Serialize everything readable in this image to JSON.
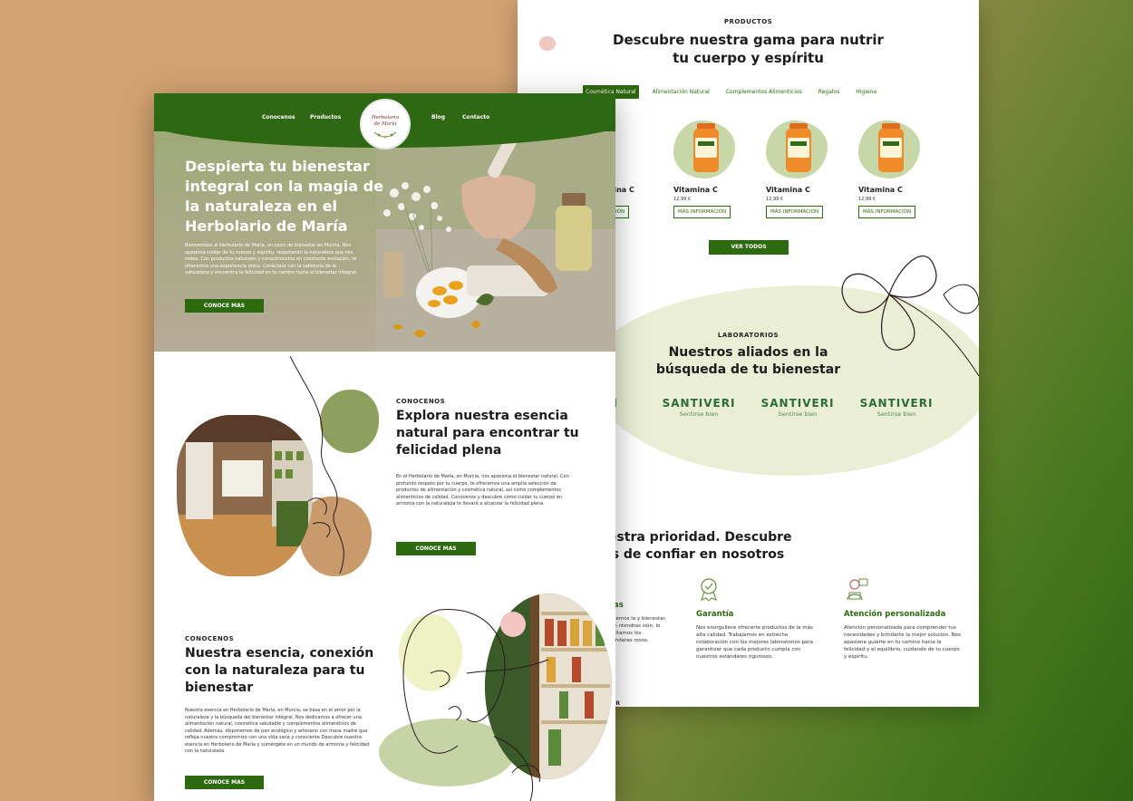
{
  "back_page": {
    "products": {
      "eyebrow": "PRODUCTOS",
      "title": "Descubre nuestra gama para nutrir tu cuerpo y espíritu",
      "tabs": [
        "Cosmética Natural",
        "Alimentación Natural",
        "Complementos Alimenticios",
        "Regalos",
        "Higiene"
      ],
      "items": [
        {
          "name": "Vitamina C",
          "price": "12,99 €",
          "button": "MÁS INFORMACIÓN"
        },
        {
          "name": "Vitamina C",
          "price": "12,99 €",
          "button": "MÁS INFORMACIÓN"
        },
        {
          "name": "Vitamina C",
          "price": "12,99 €",
          "button": "MÁS INFORMACIÓN"
        },
        {
          "name": "Vitamina C",
          "price": "12,99 €",
          "button": "MÁS INFORMACIÓN"
        }
      ],
      "view_all": "VER TODOS"
    },
    "labs": {
      "eyebrow": "LABORATORIOS",
      "title": "Nuestros aliados en la búsqueda de tu bienestar",
      "logos": [
        {
          "brand": "SANTIVERI",
          "tagline": "Sentirse bien"
        },
        {
          "brand": "SANTIVERI",
          "tagline": "Sentirse bien"
        },
        {
          "brand": "SANTIVERI",
          "tagline": "Sentirse bien"
        },
        {
          "brand": "SANTIVERI",
          "tagline": "Sentirse bien"
        }
      ]
    },
    "priority": {
      "eyebrow": "S",
      "title_line1": "nuestra prioridad. Descubre",
      "title_line2": "ajas de confiar en nosotros",
      "features": [
        {
          "title": "oras",
          "text": "rendemos la y bienestar. Si un ntendras sión, lo solicitamos los estándares rosos.",
          "icon": "leaf-icon"
        },
        {
          "title": "Garantía",
          "text": "Nos enorgullece ofrecerte productos de la más alta calidad. Trabajamos en estrecha colaboración con los mejores laboratorios para garantizar que cada producto cumpla con nuestros estándares rigurosos.",
          "icon": "award-icon"
        },
        {
          "title": "Atención personalizada",
          "text": "Atención personalizada para comprender tus necesidades y brindarte la mejor solución. Nos apasiona guiarte en tu camino hacia la felicidad y el equilibrio, cuidando de tu cuerpo y espíritu.",
          "icon": "support-icon"
        }
      ],
      "footer_fragment": "SER"
    }
  },
  "front_page": {
    "nav": {
      "links_left": [
        "Conocenos",
        "Productos"
      ],
      "links_right": [
        "Blog",
        "Contacto"
      ],
      "brand_line1": "Herbolario",
      "brand_line2": "de María"
    },
    "hero": {
      "title": "Despierta tu bienestar integral con la magia de la naturaleza en el Herbolario de María",
      "text": "Bienvenidos al Herbolario de María, un oasis de bienestar en Murcia. Nos apasiona cuidar de tu cuerpo y espíritu, respetando la naturaleza que nos rodea. Con productos naturales y conocimientos en constante evolución, te ofrecemos una experiencia única. Conéctate con la sabiduría de la naturaleza y encuentra la felicidad en tu camino hacia el bienestar integral.",
      "button": "CONOCE MAS"
    },
    "section1": {
      "eyebrow": "CONOCENOS",
      "title": "Explora nuestra esencia natural para encontrar tu felicidad plena",
      "text": "En el Herbolario de María, en Murcia, nos apasiona el bienestar natural. Con profundo respeto por tu cuerpo, te ofrecemos una amplia selección de productos de alimentación y cosmética natural, así como complementos alimenticios de calidad. Conócenos y descubre cómo cuidar tu cuerpo en armonía con la naturaleza te llevará a alcanzar la felicidad plena.",
      "button": "CONOCE MAS"
    },
    "section2": {
      "eyebrow": "CONOCENOS",
      "title": "Nuestra esencia, conexión con la naturaleza para tu bienestar",
      "text": "Nuestra esencia en Herbolario de María, en Murcia, se basa en el amor por la naturaleza y la búsqueda del bienestar integral. Nos dedicamos a ofrecer una alimentación natural, cosmética saludable y complementos alimenticios de calidad. Además, disponemos de pan ecológico y artesano con masa madre que refleja nuestro compromiso con una vida sana y consciente Descubre nuestra esencia en Herbolario de María y sumérgete en un mundo de armonía y felicidad con la naturaleza.",
      "button": "CONOCE MAS"
    }
  },
  "colors": {
    "brand_green": "#2d6a0f",
    "sage": "#c8d7a7",
    "tan": "#d2a272",
    "pink": "#f2c7c3"
  }
}
